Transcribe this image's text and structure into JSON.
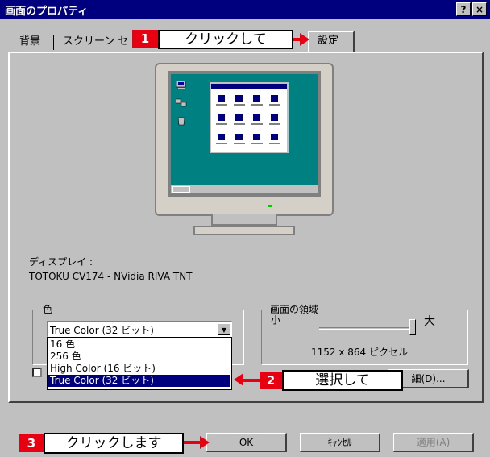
{
  "window": {
    "title": "画面のプロパティ",
    "help_label": "?",
    "close_label": "×"
  },
  "tabs": [
    {
      "label": "背景"
    },
    {
      "label": "スクリーン セ"
    },
    {
      "label": "設定"
    }
  ],
  "display": {
    "label": "ディスプレイ :",
    "value": "TOTOKU CV174 - NVidia RIVA TNT"
  },
  "color": {
    "legend": "色",
    "selected": "True Color (32 ビット)",
    "options": [
      "16 色",
      "256 色",
      "High Color (16 ビット)",
      "True Color (32 ビット)"
    ]
  },
  "resolution": {
    "legend": "画面の領域",
    "small_label": "小",
    "large_label": "大",
    "value": "1152 x 864 ピクセル",
    "slider_level": 0.95
  },
  "buttons": {
    "advanced": "細(D)...",
    "ok": "OK",
    "cancel": "ｷｬﾝｾﾙ",
    "apply": "適用(A)"
  },
  "annotations": [
    {
      "number": "1",
      "text": "クリックして"
    },
    {
      "number": "2",
      "text": "選択して"
    },
    {
      "number": "3",
      "text": "クリックします"
    }
  ],
  "colors": {
    "titlebar": "#00007f",
    "face": "#c0c0c0",
    "desktop": "#008080",
    "annotation_red": "#e60012",
    "selection": "#00007f"
  }
}
